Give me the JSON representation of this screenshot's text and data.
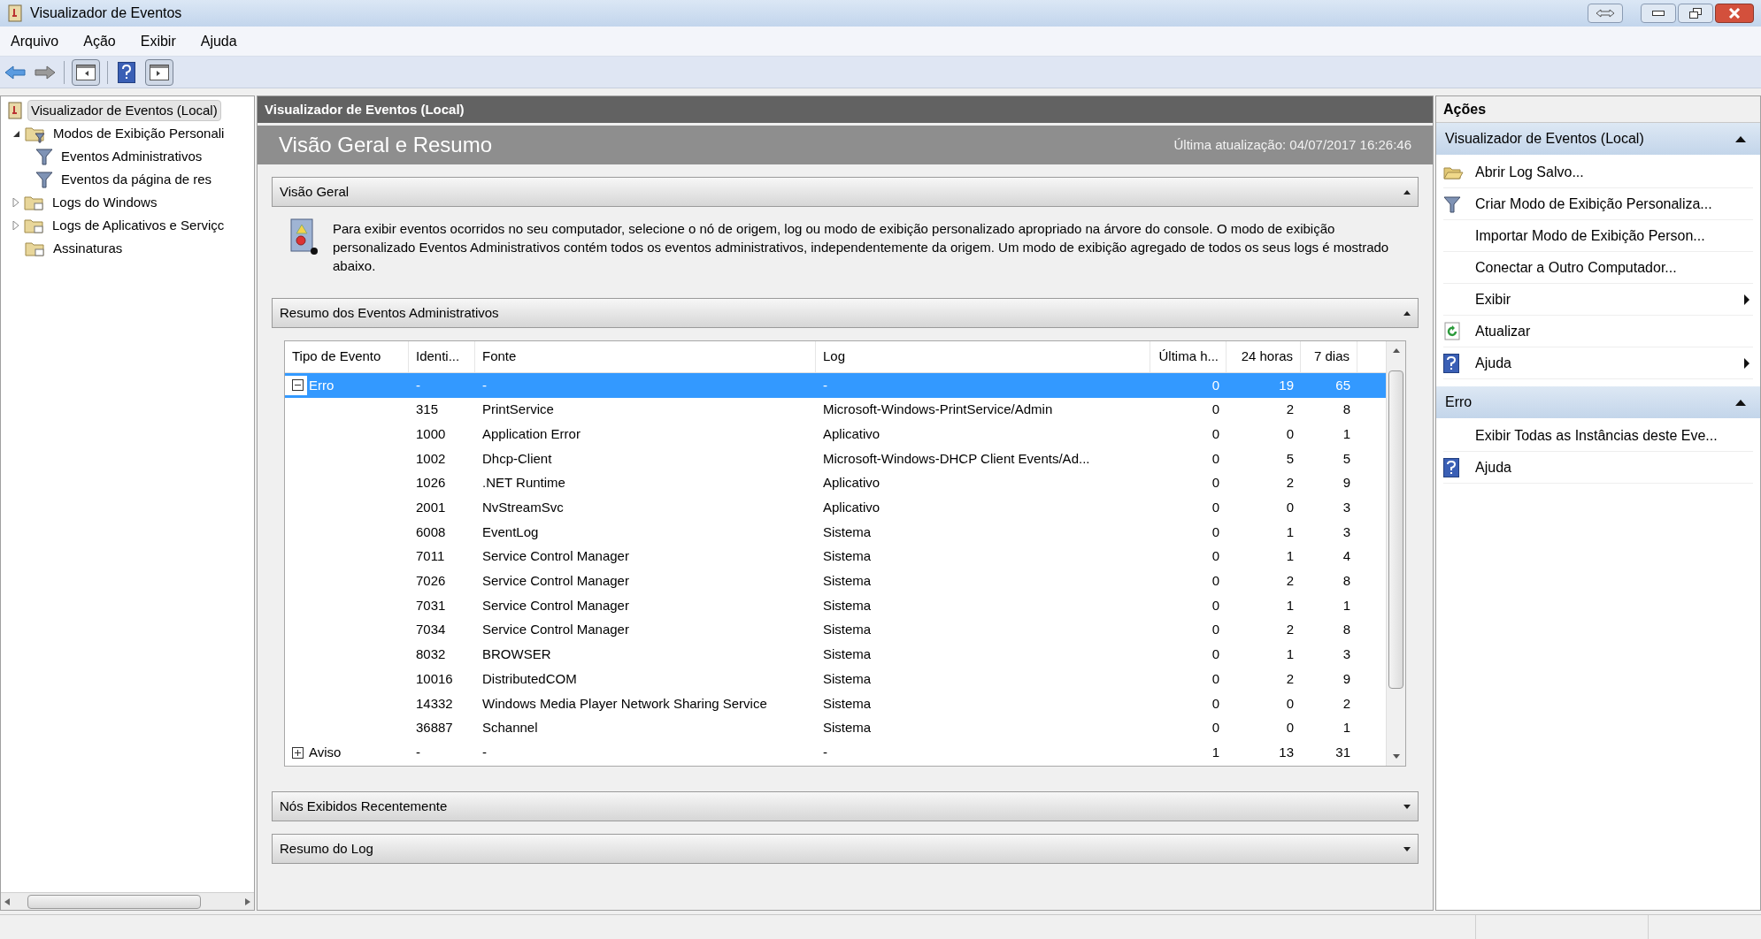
{
  "window": {
    "title": "Visualizador de Eventos"
  },
  "menu": [
    "Arquivo",
    "Ação",
    "Exibir",
    "Ajuda"
  ],
  "tree": [
    {
      "label": "Visualizador de Eventos (Local)",
      "kind": "log",
      "selected": true,
      "children": [
        {
          "label": "Modos de Exibição Personali",
          "kind": "folder-filter",
          "selected": false,
          "expanded": true,
          "children": [
            {
              "label": "Eventos Administrativos",
              "kind": "filter",
              "selected": false
            },
            {
              "label": "Eventos da página de res",
              "kind": "filter",
              "selected": false
            }
          ]
        },
        {
          "label": "Logs do Windows",
          "kind": "folder",
          "selected": false,
          "expanded": false
        },
        {
          "label": "Logs de Aplicativos e Serviçc",
          "kind": "folder",
          "selected": false,
          "expanded": false
        },
        {
          "label": "Assinaturas",
          "kind": "folder",
          "selected": false
        }
      ]
    }
  ],
  "center": {
    "header": "Visualizador de Eventos (Local)",
    "title": "Visão Geral e Resumo",
    "updated": "Última atualização: 04/07/2017 16:26:46",
    "sections": [
      {
        "title": "Visão Geral",
        "expanded": true,
        "kind": "text",
        "text": "Para exibir eventos ocorridos no seu computador, selecione o nó de origem, log ou modo de exibição personalizado apropriado na árvore do console. O modo de exibição personalizado Eventos Administrativos contém todos os eventos administrativos, independentemente da origem. Um modo de exibição agregado de todos os seus logs é mostrado abaixo."
      },
      {
        "title": "Resumo dos Eventos Administrativos",
        "expanded": true,
        "kind": "table"
      },
      {
        "title": "Nós Exibidos Recentemente",
        "expanded": false
      },
      {
        "title": "Resumo do Log",
        "expanded": false
      }
    ]
  },
  "table": {
    "columns": [
      "Tipo de Evento",
      "Identi...",
      "Fonte",
      "Log",
      "Última h...",
      "24 horas",
      "7 dias"
    ],
    "rows": [
      {
        "kind": "group",
        "type": "Erro",
        "expanded": true,
        "selected": true,
        "id": "-",
        "source": "-",
        "log": "-",
        "last": "0",
        "h24": "19",
        "d7": "65"
      },
      {
        "kind": "event",
        "id": "315",
        "source": "PrintService",
        "log": "Microsoft-Windows-PrintService/Admin",
        "last": "0",
        "h24": "2",
        "d7": "8",
        "selected": false
      },
      {
        "kind": "event",
        "id": "1000",
        "source": "Application Error",
        "log": "Aplicativo",
        "last": "0",
        "h24": "0",
        "d7": "1",
        "selected": false
      },
      {
        "kind": "event",
        "id": "1002",
        "source": "Dhcp-Client",
        "log": "Microsoft-Windows-DHCP Client Events/Ad...",
        "last": "0",
        "h24": "5",
        "d7": "5",
        "selected": false
      },
      {
        "kind": "event",
        "id": "1026",
        "source": ".NET Runtime",
        "log": "Aplicativo",
        "last": "0",
        "h24": "2",
        "d7": "9",
        "selected": false
      },
      {
        "kind": "event",
        "id": "2001",
        "source": "NvStreamSvc",
        "log": "Aplicativo",
        "last": "0",
        "h24": "0",
        "d7": "3",
        "selected": false
      },
      {
        "kind": "event",
        "id": "6008",
        "source": "EventLog",
        "log": "Sistema",
        "last": "0",
        "h24": "1",
        "d7": "3",
        "selected": false
      },
      {
        "kind": "event",
        "id": "7011",
        "source": "Service Control Manager",
        "log": "Sistema",
        "last": "0",
        "h24": "1",
        "d7": "4",
        "selected": false
      },
      {
        "kind": "event",
        "id": "7026",
        "source": "Service Control Manager",
        "log": "Sistema",
        "last": "0",
        "h24": "2",
        "d7": "8",
        "selected": false
      },
      {
        "kind": "event",
        "id": "7031",
        "source": "Service Control Manager",
        "log": "Sistema",
        "last": "0",
        "h24": "1",
        "d7": "1",
        "selected": false
      },
      {
        "kind": "event",
        "id": "7034",
        "source": "Service Control Manager",
        "log": "Sistema",
        "last": "0",
        "h24": "2",
        "d7": "8",
        "selected": false
      },
      {
        "kind": "event",
        "id": "8032",
        "source": "BROWSER",
        "log": "Sistema",
        "last": "0",
        "h24": "1",
        "d7": "3",
        "selected": false
      },
      {
        "kind": "event",
        "id": "10016",
        "source": "DistributedCOM",
        "log": "Sistema",
        "last": "0",
        "h24": "2",
        "d7": "9",
        "selected": false
      },
      {
        "kind": "event",
        "id": "14332",
        "source": "Windows Media Player Network Sharing Service",
        "log": "Sistema",
        "last": "0",
        "h24": "0",
        "d7": "2",
        "selected": false
      },
      {
        "kind": "event",
        "id": "36887",
        "source": "Schannel",
        "log": "Sistema",
        "last": "0",
        "h24": "0",
        "d7": "1",
        "selected": false
      },
      {
        "kind": "group",
        "type": "Aviso",
        "expanded": false,
        "selected": false,
        "id": "-",
        "source": "-",
        "log": "-",
        "last": "1",
        "h24": "13",
        "d7": "31"
      }
    ]
  },
  "actions": {
    "title": "Ações",
    "sections": [
      {
        "title": "Visualizador de Eventos (Local)",
        "expanded": true,
        "items": [
          {
            "label": "Abrir Log Salvo...",
            "kind": "folder",
            "submenu": false
          },
          {
            "label": "Criar Modo de Exibição Personaliza...",
            "kind": "filter",
            "submenu": false
          },
          {
            "label": "Importar Modo de Exibição Person...",
            "kind": "plain",
            "submenu": false
          },
          {
            "label": "Conectar a Outro Computador...",
            "kind": "plain",
            "submenu": false
          },
          {
            "label": "Exibir",
            "kind": "plain",
            "submenu": true
          },
          {
            "label": "Atualizar",
            "kind": "refresh",
            "submenu": false
          },
          {
            "label": "Ajuda",
            "kind": "help",
            "submenu": true
          }
        ]
      },
      {
        "title": "Erro",
        "expanded": true,
        "items": [
          {
            "label": "Exibir Todas as Instâncias deste Eve...",
            "kind": "plain",
            "submenu": false
          },
          {
            "label": "Ajuda",
            "kind": "help",
            "submenu": false
          }
        ]
      }
    ]
  }
}
